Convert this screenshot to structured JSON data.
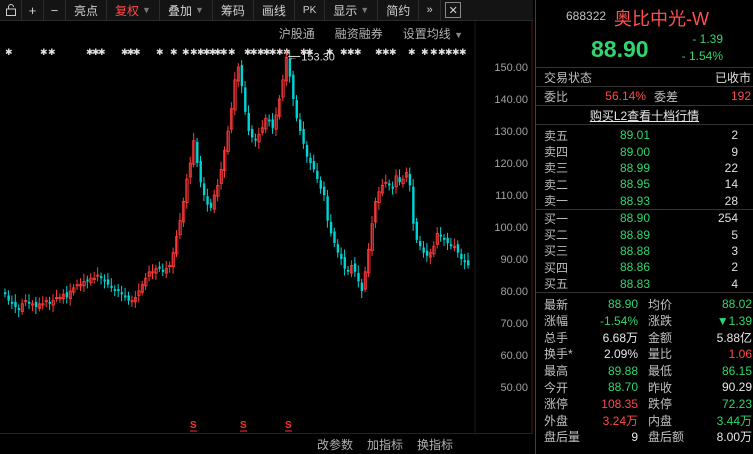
{
  "toolbar": {
    "buttons": [
      "亮点",
      "复权",
      "叠加",
      "筹码",
      "画线",
      "显示",
      "简约"
    ],
    "active": "复权"
  },
  "chart_links": [
    "沪股通",
    "融资融券",
    "设置均线"
  ],
  "chart_footer": [
    "改参数",
    "加指标",
    "换指标"
  ],
  "price_axis": [
    "150.00",
    "140.00",
    "130.00",
    "120.00",
    "110.00",
    "100.00",
    "90.00",
    "80.00",
    "70.00",
    "60.00",
    "50.00"
  ],
  "chart_data": {
    "type": "candlestick",
    "ylim": [
      45,
      155
    ],
    "max_label": "153.30",
    "closes": [
      79,
      77,
      76,
      75,
      74,
      76,
      77,
      76,
      76,
      75,
      76,
      76,
      77,
      76,
      77,
      78,
      78,
      79,
      78,
      80,
      81,
      82,
      82,
      83,
      83,
      84,
      84,
      85,
      84,
      83,
      82,
      81,
      80,
      80,
      79,
      78,
      77,
      77,
      78,
      80,
      82,
      84,
      86,
      86,
      87,
      87,
      86,
      87,
      88,
      92,
      97,
      102,
      108,
      115,
      120,
      127,
      120,
      114,
      110,
      107,
      106,
      110,
      113,
      118,
      124,
      130,
      137,
      146,
      150,
      144,
      136,
      130,
      128,
      127,
      129,
      131,
      134,
      133,
      131,
      135,
      140,
      146,
      153,
      147,
      140,
      134,
      130,
      126,
      122,
      120,
      118,
      115,
      112,
      110,
      102,
      98,
      95,
      92,
      90,
      87,
      86,
      88,
      86,
      83,
      80,
      86,
      93,
      101,
      108,
      111,
      113,
      114,
      113,
      112,
      116,
      114,
      115,
      117,
      113,
      101,
      96,
      94,
      92,
      91,
      92,
      94,
      98,
      97,
      96,
      95,
      94,
      94,
      92,
      90,
      89,
      88
    ]
  },
  "quote": {
    "code": "688322",
    "name": "奥比中光-W",
    "price": "88.90",
    "change": "- 1.39",
    "change_pct": "- 1.54%",
    "status_label": "交易状态",
    "status_value": "已收市",
    "weibi_label": "委比",
    "weibi_value": "56.14%",
    "weicha_label": "委差",
    "weicha_value": "192",
    "l2_link": "购买L2查看十档行情"
  },
  "orderbook": {
    "asks": [
      {
        "label": "卖五",
        "price": "89.01",
        "vol": "2"
      },
      {
        "label": "卖四",
        "price": "89.00",
        "vol": "9"
      },
      {
        "label": "卖三",
        "price": "88.99",
        "vol": "22"
      },
      {
        "label": "卖二",
        "price": "88.95",
        "vol": "14"
      },
      {
        "label": "卖一",
        "price": "88.93",
        "vol": "28"
      }
    ],
    "bids": [
      {
        "label": "买一",
        "price": "88.90",
        "vol": "254"
      },
      {
        "label": "买二",
        "price": "88.89",
        "vol": "5"
      },
      {
        "label": "买三",
        "price": "88.88",
        "vol": "3"
      },
      {
        "label": "买四",
        "price": "88.86",
        "vol": "2"
      },
      {
        "label": "买五",
        "price": "88.83",
        "vol": "4"
      }
    ]
  },
  "stats": [
    {
      "l1": "最新",
      "v1": "88.90",
      "c1": "green",
      "l2": "均价",
      "v2": "88.02",
      "c2": "green"
    },
    {
      "l1": "涨幅",
      "v1": "-1.54%",
      "c1": "green",
      "l2": "涨跌",
      "v2": "▼1.39",
      "c2": "green"
    },
    {
      "l1": "总手",
      "v1": "6.68万",
      "c1": "white",
      "l2": "金额",
      "v2": "5.88亿",
      "c2": "white"
    },
    {
      "l1": "换手*",
      "v1": "2.09%",
      "c1": "white",
      "l2": "量比",
      "v2": "1.06",
      "c2": "red"
    },
    {
      "l1": "最高",
      "v1": "89.88",
      "c1": "green",
      "l2": "最低",
      "v2": "86.15",
      "c2": "green"
    },
    {
      "l1": "今开",
      "v1": "88.70",
      "c1": "green",
      "l2": "昨收",
      "v2": "90.29",
      "c2": "white"
    },
    {
      "l1": "涨停",
      "v1": "108.35",
      "c1": "red",
      "l2": "跌停",
      "v2": "72.23",
      "c2": "green"
    },
    {
      "l1": "外盘",
      "v1": "3.24万",
      "c1": "red",
      "l2": "内盘",
      "v2": "3.44万",
      "c2": "green"
    },
    {
      "l1": "盘后量",
      "v1": "9",
      "c1": "white",
      "l2": "盘后额",
      "v2": "8.00万",
      "c2": "white"
    }
  ],
  "colors": {
    "up": "#ff3b3b",
    "down": "#00d4d4",
    "green": "#2ed66e"
  }
}
